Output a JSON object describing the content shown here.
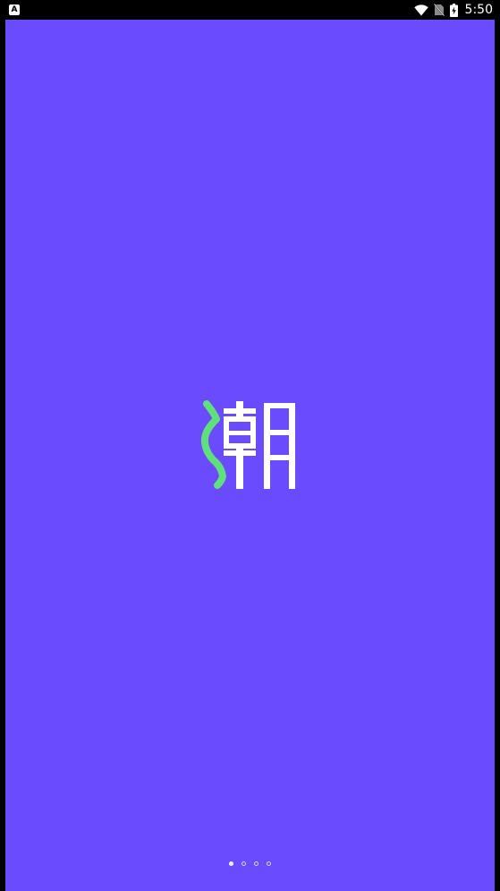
{
  "status_bar": {
    "app_icon_glyph": "A",
    "time": "5:50",
    "icons": [
      "wifi-icon",
      "no-sim-icon",
      "battery-charging-icon"
    ]
  },
  "splash": {
    "background_color": "#6a4cfe",
    "logo": {
      "text": "潮",
      "accent_color": "#5fe07d",
      "main_color": "#ffffff"
    },
    "pager": {
      "total_pages": 4,
      "current_page": 1
    }
  }
}
